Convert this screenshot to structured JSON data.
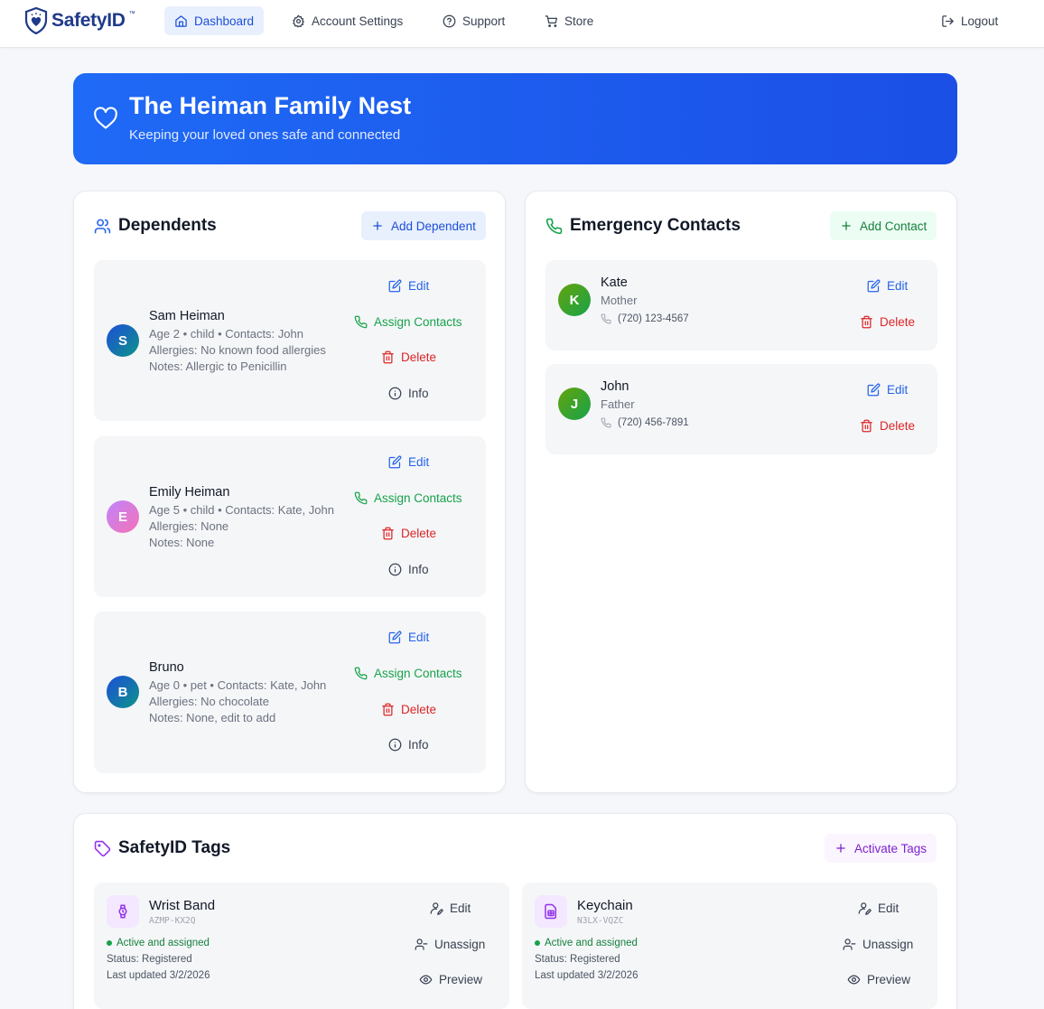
{
  "nav": {
    "logo": "SafetyID",
    "logo_tm": "™",
    "items": [
      {
        "label": "Dashboard",
        "icon": "home-icon"
      },
      {
        "label": "Account Settings",
        "icon": "gear-icon"
      },
      {
        "label": "Support",
        "icon": "help-circle-icon"
      },
      {
        "label": "Store",
        "icon": "cart-icon"
      }
    ],
    "logout": "Logout"
  },
  "hero": {
    "title": "The Heiman Family Nest",
    "subtitle": "Keeping your loved ones safe and connected"
  },
  "dependents": {
    "title": "Dependents",
    "add_label": "Add Dependent",
    "items": [
      {
        "initial": "S",
        "name": "Sam Heiman",
        "meta": "Age 2 • child • Contacts: John",
        "allergies": "Allergies: No known food allergies",
        "notes": "Notes: Allergic to Penicillin",
        "avatar_color": "#0e7490"
      },
      {
        "initial": "E",
        "name": "Emily Heiman",
        "meta": "Age 5 • child • Contacts: Kate, John",
        "allergies": "Allergies: None",
        "notes": "Notes: None",
        "avatar_color": "#e879f9"
      },
      {
        "initial": "B",
        "name": "Bruno",
        "meta": "Age 0 • pet • Contacts: Kate, John",
        "allergies": "Allergies: No chocolate",
        "notes": "Notes: None, edit to add",
        "avatar_color": "#0e7490"
      }
    ],
    "actions": {
      "edit": "Edit",
      "assign": "Assign Contacts",
      "delete": "Delete",
      "info": "Info"
    }
  },
  "contacts": {
    "title": "Emergency Contacts",
    "add_label": "Add Contact",
    "items": [
      {
        "initial": "K",
        "name": "Kate",
        "relation": "Mother",
        "phone": "(720) 123-4567"
      },
      {
        "initial": "J",
        "name": "John",
        "relation": "Father",
        "phone": "(720) 456-7891"
      }
    ],
    "actions": {
      "edit": "Edit",
      "delete": "Delete"
    }
  },
  "tags": {
    "title": "SafetyID Tags",
    "activate_label": "Activate Tags",
    "items": [
      {
        "name": "Wrist Band",
        "code": "AZMP-KX2Q",
        "icon": "watch-icon",
        "status_text": "Active and assigned",
        "status": "Status: Registered",
        "updated": "Last updated 3/2/2026"
      },
      {
        "name": "Keychain",
        "code": "N3LX-VQZC",
        "icon": "sim-card-icon",
        "status_text": "Active and assigned",
        "status": "Status: Registered",
        "updated": "Last updated 3/2/2026"
      }
    ],
    "actions": {
      "edit": "Edit",
      "unassign": "Unassign",
      "preview": "Preview"
    }
  },
  "colors": {
    "brand": "#1e3a8a",
    "hero": "#1f6af6",
    "blue": "#2563eb",
    "green": "#16a34a",
    "red": "#dc2626",
    "purple": "#9333ea"
  }
}
